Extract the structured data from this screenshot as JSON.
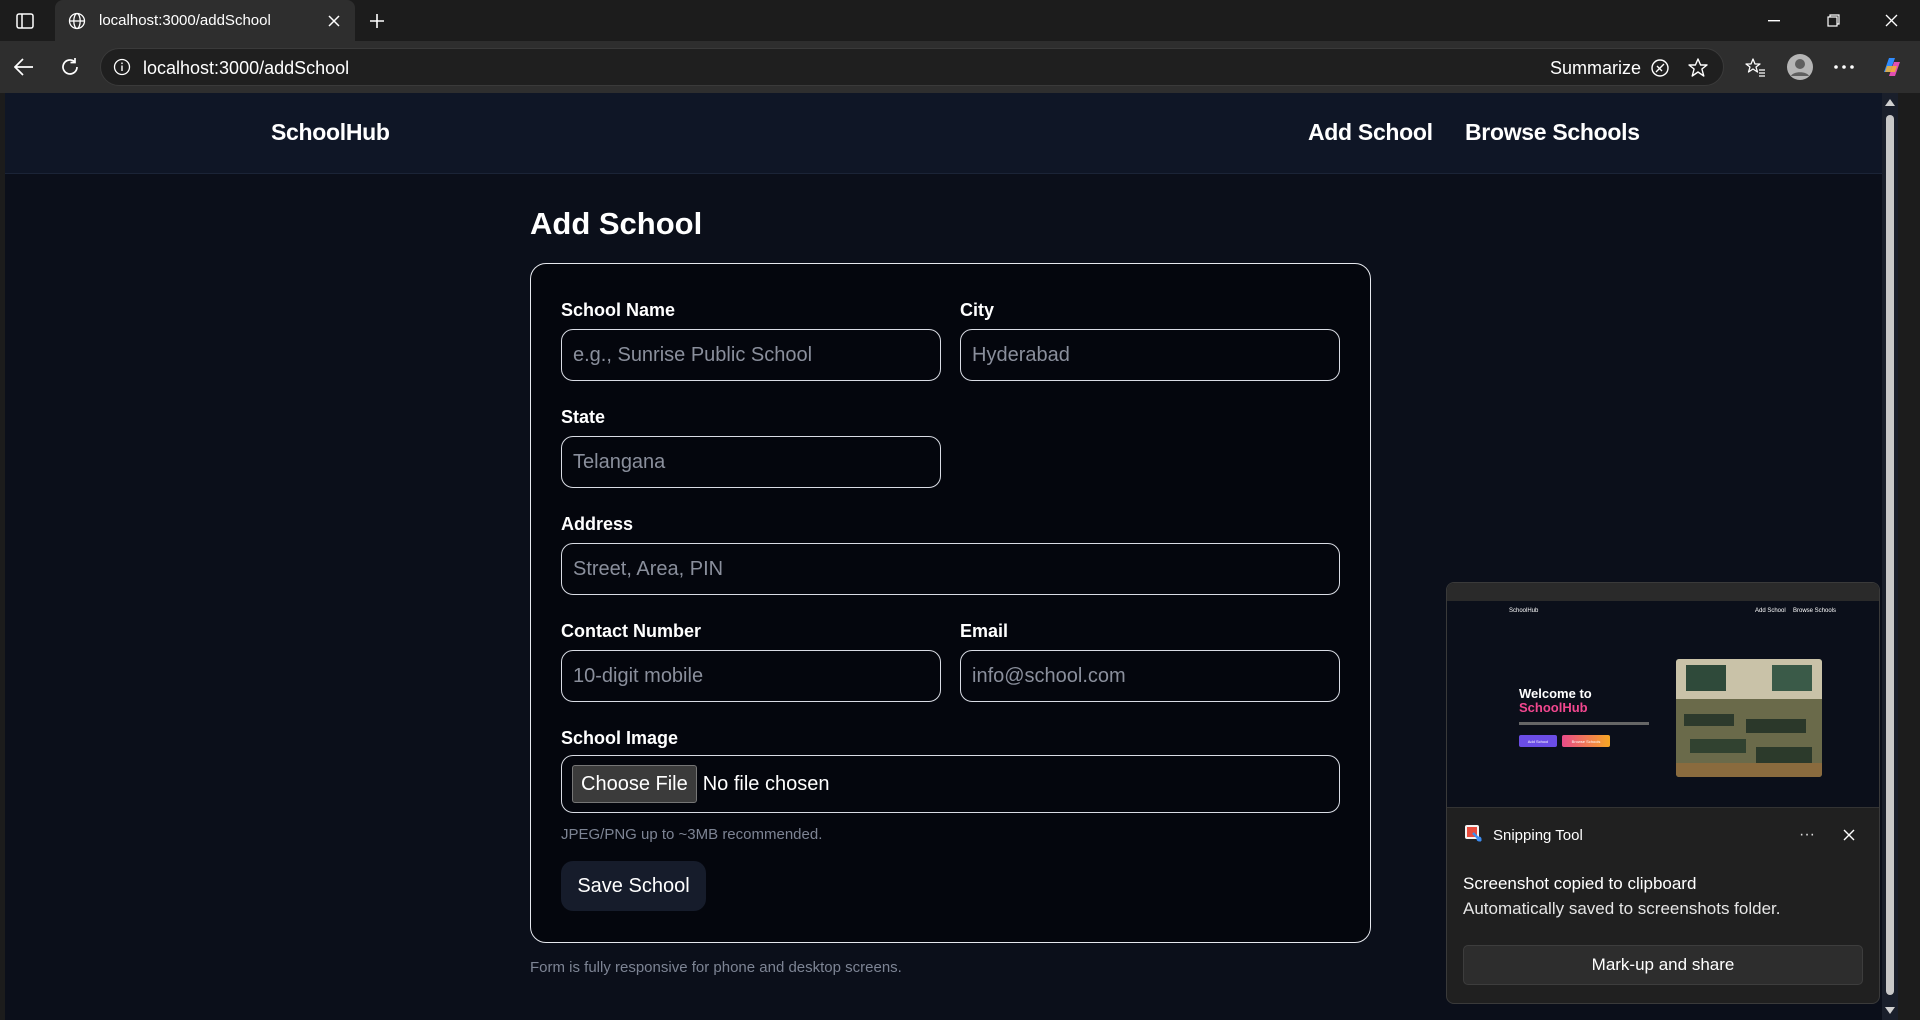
{
  "browser": {
    "tab_title": "localhost:3000/addSchool",
    "url": "localhost:3000/addSchool",
    "summarize_label": "Summarize"
  },
  "site": {
    "brand": "SchoolHub",
    "nav": [
      "Add School",
      "Browse Schools"
    ]
  },
  "page": {
    "title": "Add School",
    "footnote": "Form is fully responsive for phone and desktop screens."
  },
  "form": {
    "school_name": {
      "label": "School Name",
      "placeholder": "e.g., Sunrise Public School",
      "value": ""
    },
    "city": {
      "label": "City",
      "placeholder": "Hyderabad",
      "value": ""
    },
    "state": {
      "label": "State",
      "placeholder": "Telangana",
      "value": ""
    },
    "address": {
      "label": "Address",
      "placeholder": "Street, Area, PIN",
      "value": ""
    },
    "contact": {
      "label": "Contact Number",
      "placeholder": "10-digit mobile",
      "value": ""
    },
    "email": {
      "label": "Email",
      "placeholder": "info@school.com",
      "value": ""
    },
    "image": {
      "label": "School Image",
      "button": "Choose File",
      "status": "No file chosen",
      "hint": "JPEG/PNG up to ~3MB recommended."
    },
    "submit_label": "Save School"
  },
  "toast": {
    "app_name": "Snipping Tool",
    "message": "Screenshot copied to clipboard",
    "submessage": "Automatically saved to screenshots folder.",
    "action": "Mark-up and share",
    "preview": {
      "brand": "SchoolHub",
      "nav": [
        "Add School",
        "Browse Schools"
      ],
      "headline_1": "Welcome to",
      "headline_2": "SchoolHub",
      "btn_1": "Add School",
      "btn_2": "Browse Schools"
    }
  },
  "colors": {
    "page_bg": "#0b0f1a",
    "card_bg": "#04060d",
    "nav_bg": "#0f1626",
    "chrome_bg": "#2e2e2e",
    "accent_pink": "#f2478f"
  }
}
